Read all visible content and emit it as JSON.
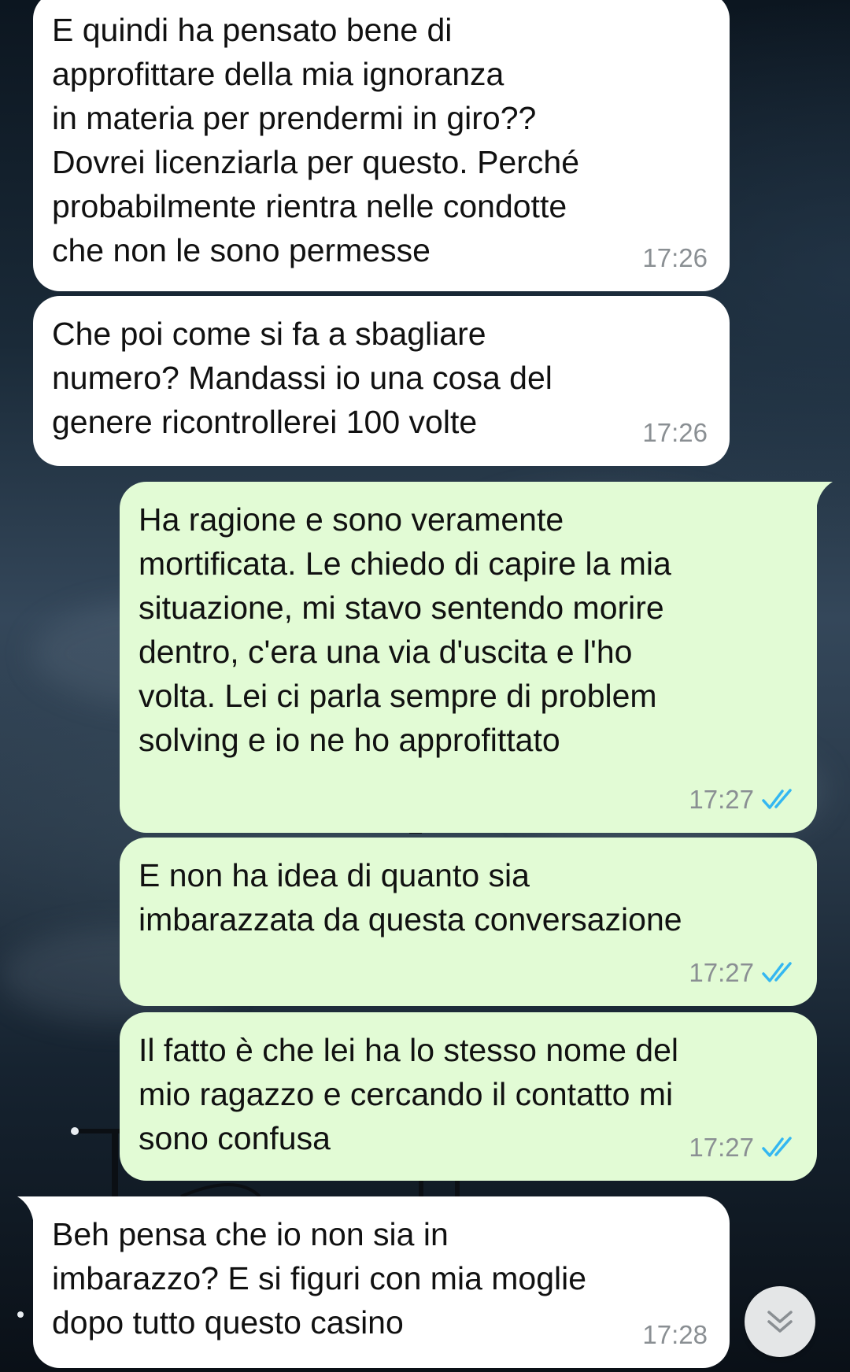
{
  "messages": [
    {
      "direction": "incoming",
      "text": "E quindi ha pensato bene di\napprofittare della mia ignoranza\nin materia per prendermi in giro??\nDovrei licenziarla per questo. Perché\nprobabilmente rientra nelle condotte\nche non le sono permesse",
      "time": "17:26"
    },
    {
      "direction": "incoming",
      "text": "Che poi come si fa a sbagliare\nnumero? Mandassi io una cosa del\ngenere ricontrollerei 100 volte",
      "time": "17:26"
    },
    {
      "direction": "outgoing",
      "text": "Ha ragione e sono veramente\nmortificata. Le chiedo di capire la mia\nsituazione, mi stavo sentendo morire\ndentro, c'era una via d'uscita e l'ho\nvolta. Lei ci parla sempre di problem\nsolving e io ne ho approfittato",
      "time": "17:27",
      "status": "read"
    },
    {
      "direction": "outgoing",
      "text": "E non ha idea di quanto sia\nimbarazzata da questa conversazione",
      "time": "17:27",
      "status": "read"
    },
    {
      "direction": "outgoing",
      "text": "Il fatto è che lei ha lo stesso nome del\nmio ragazzo e cercando il contatto mi\nsono confusa",
      "time": "17:27",
      "status": "read"
    },
    {
      "direction": "incoming",
      "text": "Beh pensa che io non sia in\nimbarazzo? E si figuri con mia moglie\ndopo tutto questo casino",
      "time": "17:28"
    }
  ],
  "colors": {
    "incoming_bubble": "#ffffff",
    "outgoing_bubble": "#e2fbd5",
    "timestamp": "#8a8f93",
    "read_ticks": "#34b7f1"
  },
  "icons": {
    "read_receipt": "double-check-icon",
    "scroll_down": "double-chevron-down-icon"
  }
}
